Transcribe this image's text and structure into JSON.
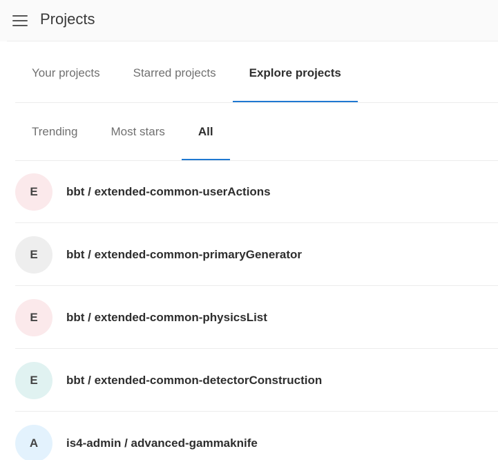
{
  "header": {
    "title": "Projects",
    "menu_icon": "hamburger-menu-icon"
  },
  "primary_tabs": [
    {
      "label": "Your projects",
      "active": false
    },
    {
      "label": "Starred projects",
      "active": false
    },
    {
      "label": "Explore projects",
      "active": true
    }
  ],
  "secondary_tabs": [
    {
      "label": "Trending",
      "active": false
    },
    {
      "label": "Most stars",
      "active": false
    },
    {
      "label": "All",
      "active": true
    }
  ],
  "projects": [
    {
      "initial": "E",
      "name": "bbt / extended-common-userActions",
      "avatar_color": "#fbe9eb"
    },
    {
      "initial": "E",
      "name": "bbt / extended-common-primaryGenerator",
      "avatar_color": "#eeeeee"
    },
    {
      "initial": "E",
      "name": "bbt / extended-common-physicsList",
      "avatar_color": "#fbe9eb"
    },
    {
      "initial": "E",
      "name": "bbt / extended-common-detectorConstruction",
      "avatar_color": "#e0f2f1"
    },
    {
      "initial": "A",
      "name": "is4-admin / advanced-gammaknife",
      "avatar_color": "#e3f2fd"
    }
  ],
  "colors": {
    "active_tab_underline": "#1f78d1",
    "header_background": "#fafafa",
    "divider": "#ececec"
  }
}
